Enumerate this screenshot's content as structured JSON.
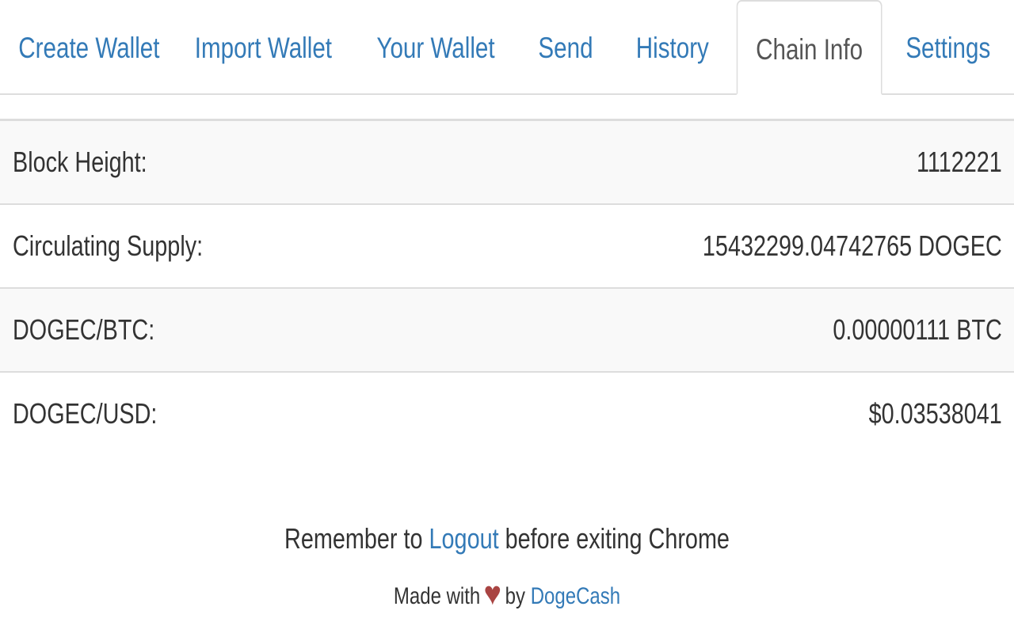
{
  "tabs": [
    {
      "label": "Create Wallet",
      "active": false
    },
    {
      "label": "Import Wallet",
      "active": false
    },
    {
      "label": "Your Wallet",
      "active": false
    },
    {
      "label": "Send",
      "active": false
    },
    {
      "label": "History",
      "active": false
    },
    {
      "label": "Chain Info",
      "active": true
    },
    {
      "label": "Settings",
      "active": false
    }
  ],
  "chain_info": [
    {
      "label": "Block Height:",
      "value": "1112221"
    },
    {
      "label": "Circulating Supply:",
      "value": "15432299.04742765 DOGEC"
    },
    {
      "label": "DOGEC/BTC:",
      "value": "0.00000111 BTC"
    },
    {
      "label": "DOGEC/USD:",
      "value": "$0.03538041"
    }
  ],
  "footer": {
    "remember_prefix": "Remember to ",
    "logout_link": "Logout",
    "remember_suffix": " before exiting Chrome",
    "made_with": "Made with ",
    "heart": "♥",
    "by": " by ",
    "brand_link": "DogeCash"
  },
  "colors": {
    "link": "#337ab7",
    "heart": "#a94442"
  }
}
